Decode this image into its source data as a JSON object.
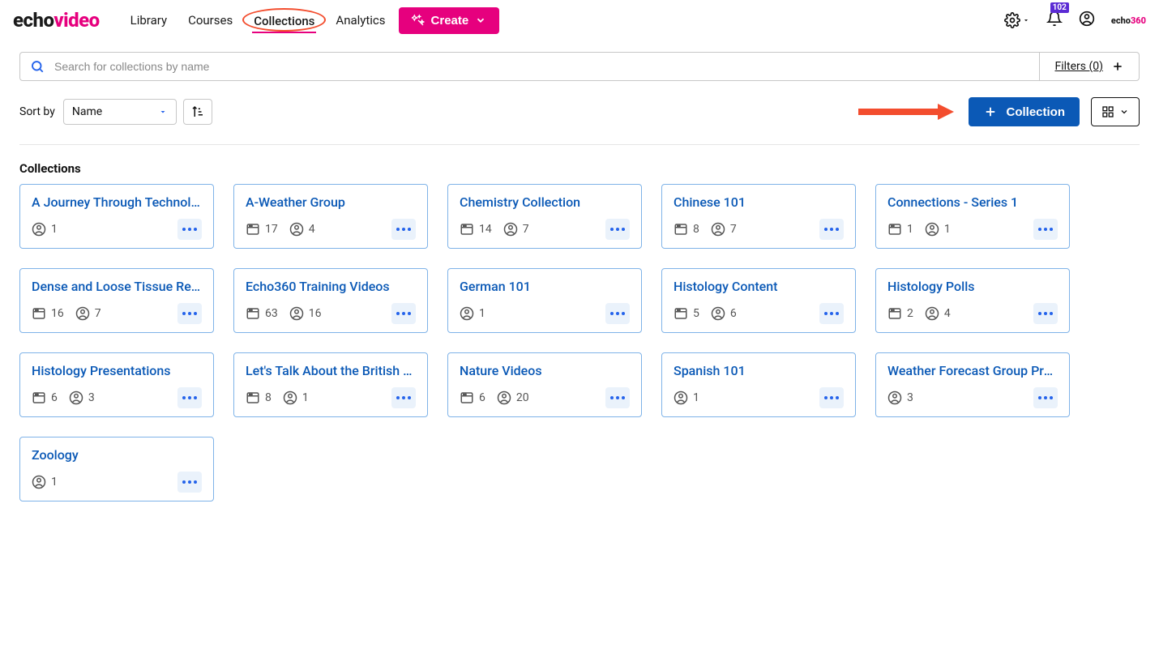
{
  "brand": {
    "echo": "echo",
    "video": "video"
  },
  "nav": {
    "library": "Library",
    "courses": "Courses",
    "collections": "Collections",
    "analytics": "Analytics"
  },
  "create_label": "Create",
  "notifications": {
    "count": "102"
  },
  "search": {
    "placeholder": "Search for collections by name"
  },
  "filters_label": "Filters (0)",
  "sortby_label": "Sort by",
  "sortby_value": "Name",
  "new_collection_label": "Collection",
  "section_title": "Collections",
  "collections": [
    {
      "title": "A Journey Through Technology",
      "users": 1
    },
    {
      "title": "A-Weather Group",
      "media": 17,
      "users": 4
    },
    {
      "title": "Chemistry Collection",
      "media": 14,
      "users": 7
    },
    {
      "title": "Chinese 101",
      "media": 8,
      "users": 7
    },
    {
      "title": "Connections - Series 1",
      "media": 1,
      "users": 1
    },
    {
      "title": "Dense and Loose Tissue Revi...",
      "media": 16,
      "users": 7
    },
    {
      "title": "Echo360 Training Videos",
      "media": 63,
      "users": 16
    },
    {
      "title": "German 101",
      "users": 1
    },
    {
      "title": "Histology Content",
      "media": 5,
      "users": 6
    },
    {
      "title": "Histology Polls",
      "media": 2,
      "users": 4
    },
    {
      "title": "Histology Presentations",
      "media": 6,
      "users": 3
    },
    {
      "title": "Let's Talk About the British Mo...",
      "media": 8,
      "users": 1
    },
    {
      "title": "Nature Videos",
      "media": 6,
      "users": 20
    },
    {
      "title": "Spanish 101",
      "users": 1
    },
    {
      "title": "Weather Forecast Group Proje...",
      "users": 3
    },
    {
      "title": "Zoology",
      "users": 1
    }
  ]
}
